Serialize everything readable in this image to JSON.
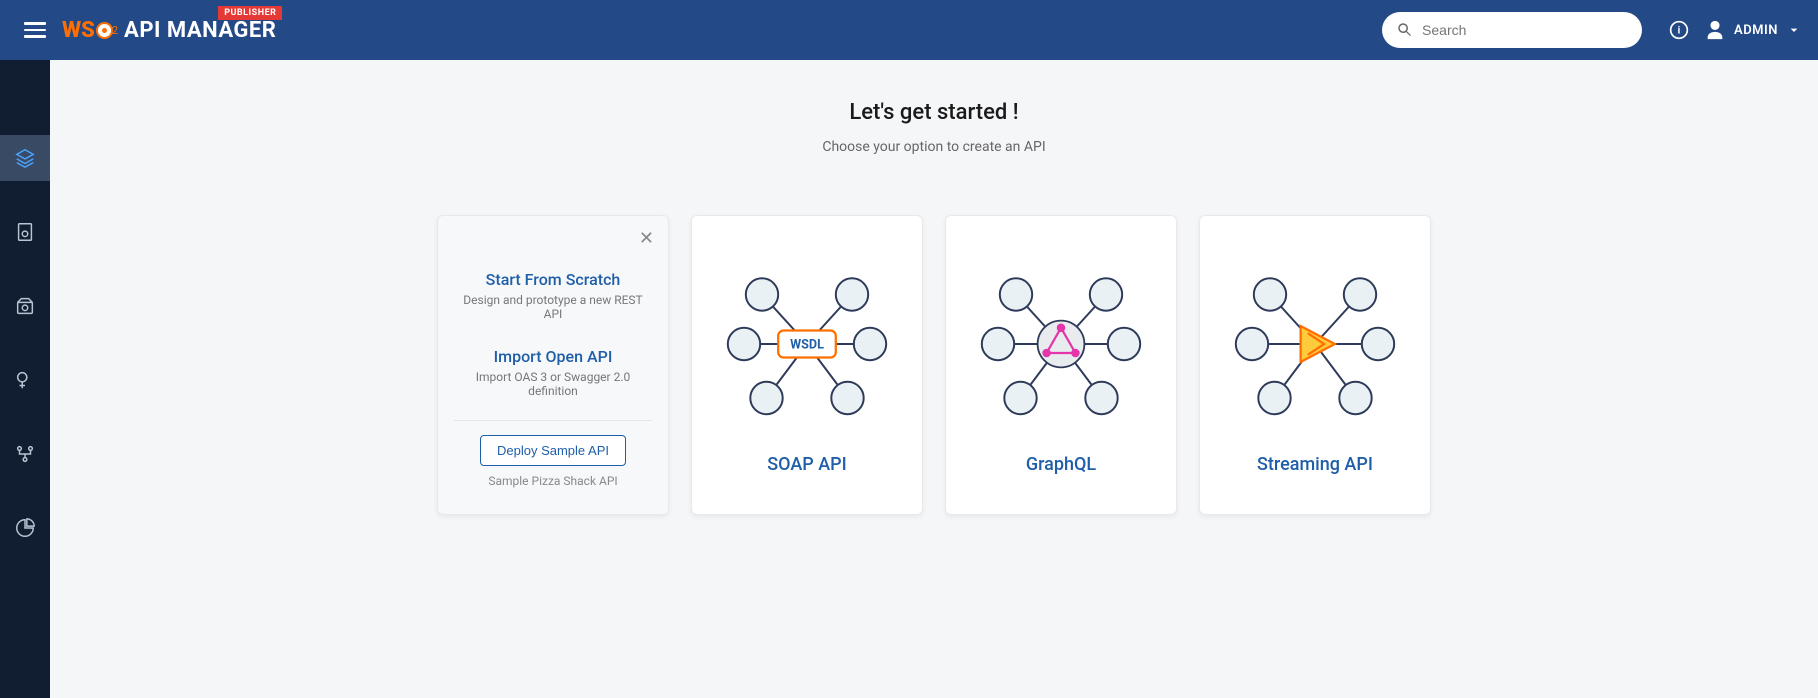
{
  "header": {
    "publisher_badge": "PUBLISHER",
    "logo_ws": "WS",
    "logo_sub": "2",
    "app_name": "API MANAGER",
    "search_placeholder": "Search",
    "user_name": "ADMIN"
  },
  "page": {
    "title": "Let's get started !",
    "subtitle": "Choose your option to create an API"
  },
  "first_card": {
    "scratch_title": "Start From Scratch",
    "scratch_sub": "Design and prototype a new REST API",
    "import_title": "Import Open API",
    "import_sub": "Import OAS 3 or Swagger 2.0 definition",
    "sample_btn": "Deploy Sample API",
    "sample_sub": "Sample Pizza Shack API"
  },
  "cards": {
    "soap": "SOAP API",
    "graphql": "GraphQL",
    "streaming": "Streaming API",
    "wsdl_badge": "WSDL"
  }
}
